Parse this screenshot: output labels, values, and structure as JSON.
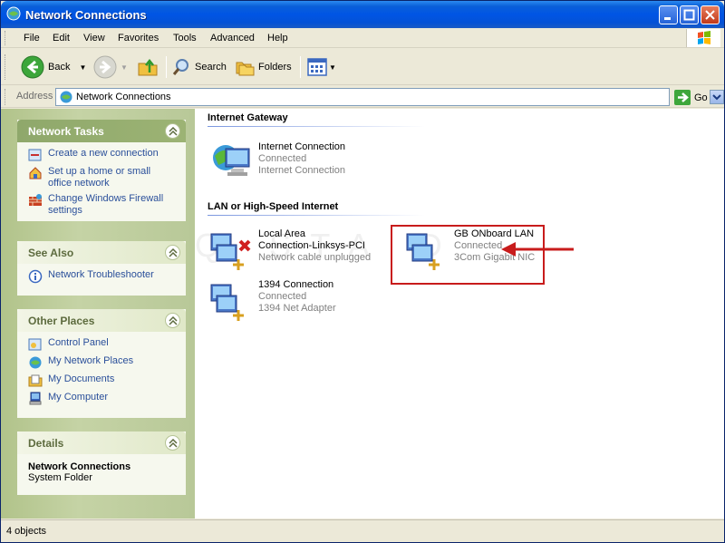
{
  "window": {
    "title": "Network Connections"
  },
  "menu": [
    "File",
    "Edit",
    "View",
    "Favorites",
    "Tools",
    "Advanced",
    "Help"
  ],
  "toolbar": {
    "back": "Back",
    "search": "Search",
    "folders": "Folders"
  },
  "address": {
    "label": "Address",
    "value": "Network Connections",
    "go": "Go"
  },
  "left": {
    "network_tasks": {
      "title": "Network Tasks",
      "items": [
        "Create a new connection",
        "Set up a home or small office network",
        "Change Windows Firewall settings"
      ]
    },
    "see_also": {
      "title": "See Also",
      "items": [
        "Network Troubleshooter"
      ]
    },
    "other_places": {
      "title": "Other Places",
      "items": [
        "Control Panel",
        "My Network Places",
        "My Documents",
        "My Computer"
      ]
    },
    "details": {
      "title": "Details",
      "name": "Network Connections",
      "type": "System Folder"
    }
  },
  "groups": [
    {
      "title": "Internet Gateway"
    },
    {
      "title": "LAN or High-Speed Internet"
    }
  ],
  "connections": [
    {
      "name": "Internet Connection",
      "status": "Connected",
      "device": "Internet Connection"
    },
    {
      "name_line1": "Local Area",
      "name_line2": "Connection-Linksys-PCI",
      "device": "Network cable unplugged"
    },
    {
      "name": "GB ONboard LAN",
      "status": "Connected",
      "device": "3Com Gigabit NIC"
    },
    {
      "name": "1394 Connection",
      "status": "Connected",
      "device": "1394 Net Adapter"
    }
  ],
  "status": {
    "text": "4 objects"
  }
}
